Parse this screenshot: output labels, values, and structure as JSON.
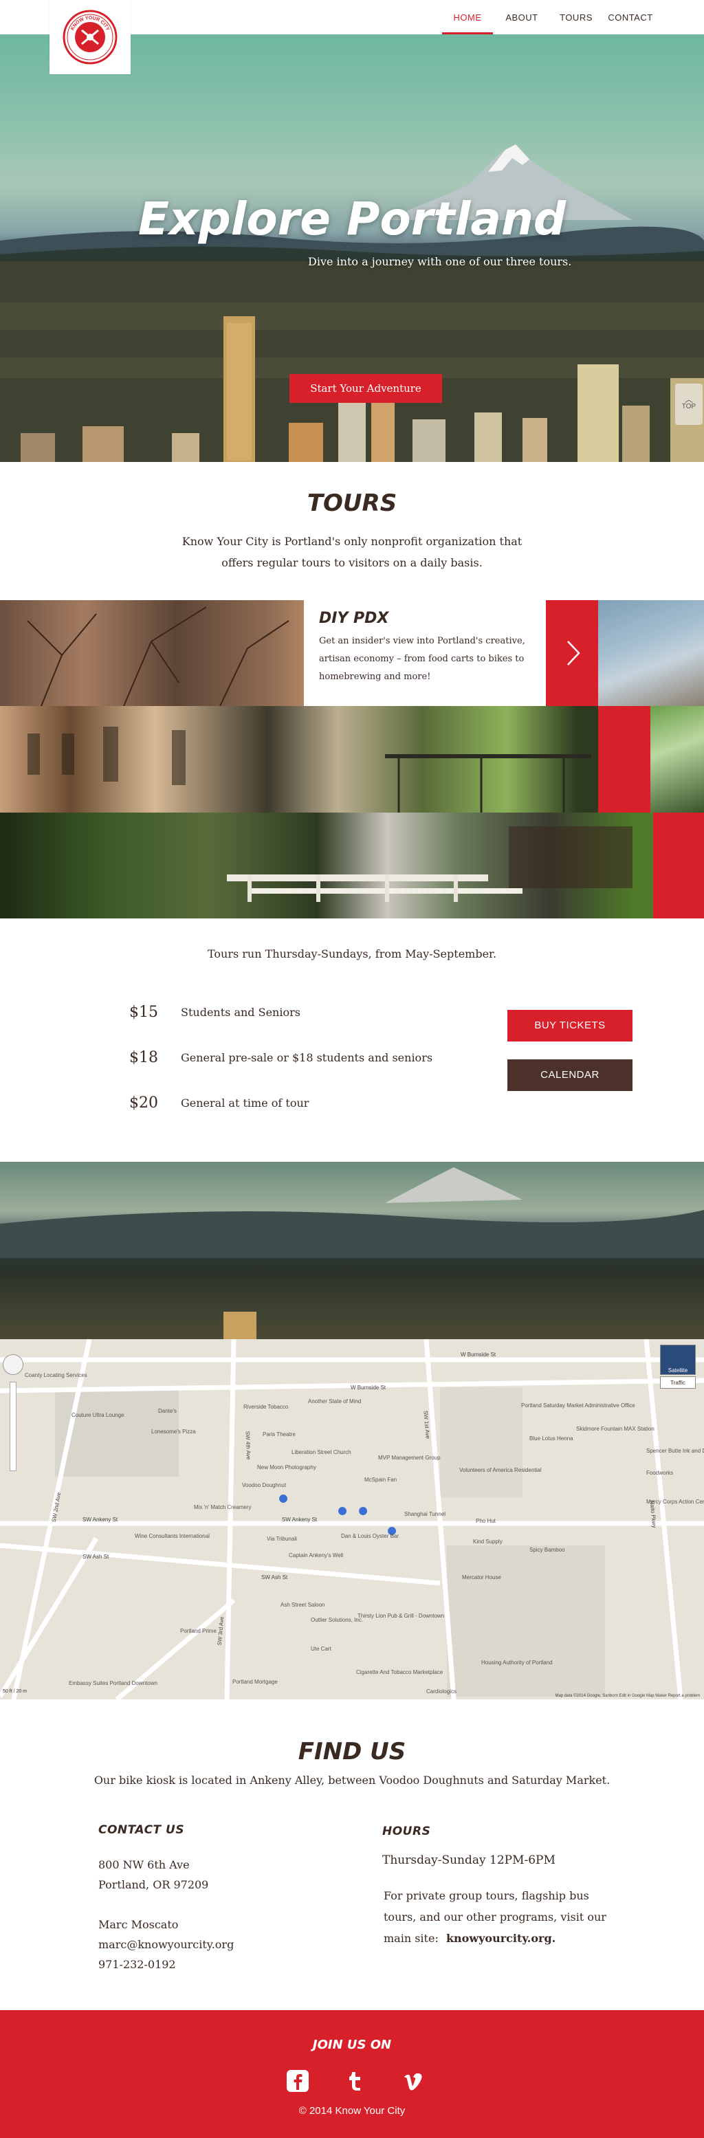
{
  "nav": {
    "items": [
      {
        "label": "HOME",
        "active": true
      },
      {
        "label": "ABOUT"
      },
      {
        "label": "TOURS"
      },
      {
        "label": "CONTACT"
      }
    ],
    "logo_text": "KNOW YOUR CITY"
  },
  "hero": {
    "title": "Explore Portland",
    "subtitle": "Dive into a journey with one of our three tours.",
    "cta": "Start Your Adventure",
    "top_label": "TOP"
  },
  "tours": {
    "title": "TOURS",
    "description": "Know Your City is Portland's only nonprofit organization that offers regular tours to visitors on a daily basis.",
    "featured": {
      "name": "DIY PDX",
      "text": "Get an insider's view into Portland's creative, artisan economy – from food carts to bikes to homebrewing and more!"
    },
    "schedule": "Tours run Thursday-Sundays, from May-September.",
    "prices": [
      {
        "price": "$15",
        "desc": "Students and Seniors"
      },
      {
        "price": "$18",
        "desc": "General pre-sale or $18 students and seniors"
      },
      {
        "price": "$20",
        "desc": "General at time of tour"
      }
    ],
    "buy_label": "BUY TICKETS",
    "calendar_label": "CALENDAR"
  },
  "map": {
    "streets": [
      "W Burnside St",
      "W Burnside St",
      "SW Ankeny St",
      "SW Ankeny St",
      "SW Ash St",
      "SW Ash St",
      "SW 3rd Ave",
      "SW 2nd Ave",
      "SW 4th Ave",
      "SW 1st Ave",
      "Naito Pkwy"
    ],
    "places": [
      "Couture Ultra Lounge",
      "Dante's",
      "Lonesome's Pizza",
      "Riverside Tobacco",
      "Another State of Mind",
      "Paris Theatre",
      "Liberation Street Church",
      "New Moon Photography",
      "Voodoo Doughnut",
      "MVP Management Group",
      "McSpain Fan",
      "Mix 'n' Match Creamery",
      "Wine Consultants International",
      "Via Tribunali",
      "Captain Ankeny's Well",
      "Dan & Louis Oyster Bar",
      "Shanghai Tunnel",
      "Ash Street Saloon",
      "Outlier Solutions, Inc.",
      "Thirsty Lion Pub & Grill - Downtown",
      "Portland Prime",
      "Embassy Suites Portland Downtown",
      "Portland Mortgage",
      "Cigarette And Tobacco Marketplace",
      "Cardiologics",
      "Ute Cart",
      "Volunteers of America Residential",
      "Portland Saturday Market Administrative Office",
      "Blue Lotus Henna",
      "Skidmore Fountain MAX Station",
      "Spencer Butte Ink and Dye",
      "Foodworks",
      "Mercy Corps Action Center",
      "Kind Supply",
      "Spicy Bamboo",
      "Mercator House",
      "Housing Authority of Portland",
      "Pho Hut",
      "Coanty Locating Services"
    ],
    "satellite": "Satellite",
    "traffic": "Traffic",
    "footer": "Map data ©2014 Google, Sanborn   Edit in Google Map Maker   Report a problem",
    "scale": "50 ft / 20 m"
  },
  "find": {
    "title": "FIND US",
    "description": "Our bike kiosk is located in Ankeny Alley, between Voodoo Doughnuts and Saturday Market.",
    "contact_title": "CONTACT US",
    "address1": "800 NW 6th Ave",
    "address2": "Portland, OR 97209",
    "person": "Marc Moscato",
    "email": "marc@knowyourcity.org",
    "phone": "971-232-0192",
    "hours_title": "HOURS",
    "hours": "Thursday-Sunday 12PM-6PM",
    "private_text": "For private group tours, flagship bus tours, and our other programs, visit our main site:",
    "site": "knowyourcity.org."
  },
  "footer": {
    "join": "JOIN US ON",
    "copyright": "© 2014 Know Your City"
  },
  "colors": {
    "accent": "#d8202a",
    "brown": "#4b3129",
    "text": "#3a2a22"
  }
}
